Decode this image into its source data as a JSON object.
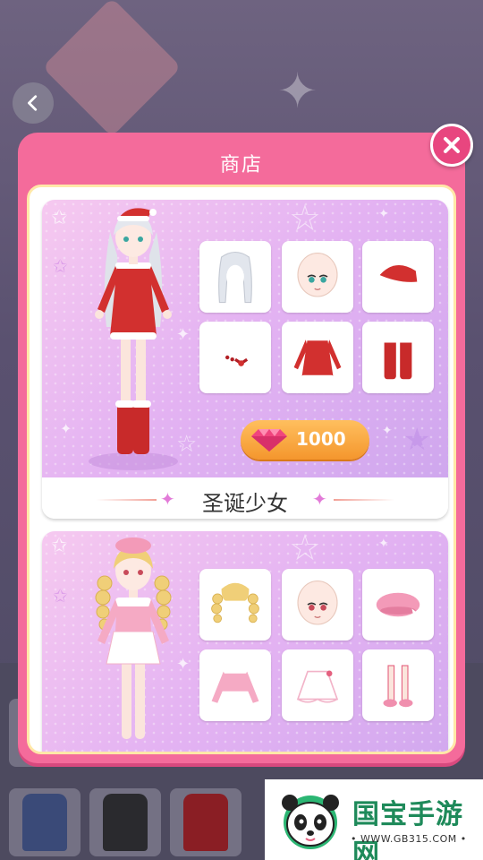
{
  "shop": {
    "title": "商店",
    "close_icon": "close-icon"
  },
  "background": {
    "back_icon": "chevron-left-icon"
  },
  "sets": [
    {
      "name": "圣诞少女",
      "price": "1000",
      "currency_icon": "gem-icon",
      "items": [
        "hair-icon",
        "face-icon",
        "santa-hat-icon",
        "accessory-icon",
        "dress-icon",
        "boots-icon"
      ]
    },
    {
      "name": "",
      "items": [
        "hair-icon",
        "face-icon",
        "beret-icon",
        "top-icon",
        "skirt-icon",
        "shoes-icon"
      ]
    }
  ],
  "watermark": {
    "name": "国宝手游网",
    "url": "• WWW.GB315.COM •"
  },
  "colors": {
    "modal": "#f46b9b",
    "price_button": "#f4962d",
    "accent_red": "#d2302f",
    "accent_pink": "#f2a3c0"
  }
}
